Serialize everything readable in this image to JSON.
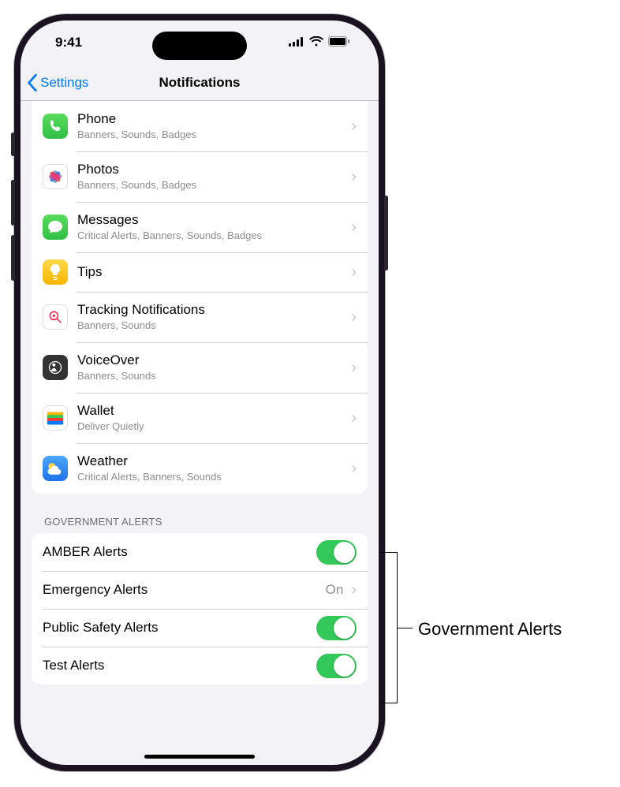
{
  "status": {
    "time": "9:41"
  },
  "nav": {
    "back": "Settings",
    "title": "Notifications"
  },
  "apps": [
    {
      "title": "Phone",
      "subtitle": "Banners, Sounds, Badges",
      "icon": "phone"
    },
    {
      "title": "Photos",
      "subtitle": "Banners, Sounds, Badges",
      "icon": "photos"
    },
    {
      "title": "Messages",
      "subtitle": "Critical Alerts, Banners, Sounds, Badges",
      "icon": "messages"
    },
    {
      "title": "Tips",
      "subtitle": "",
      "icon": "tips"
    },
    {
      "title": "Tracking Notifications",
      "subtitle": "Banners, Sounds",
      "icon": "tracking"
    },
    {
      "title": "VoiceOver",
      "subtitle": "Banners, Sounds",
      "icon": "voiceover"
    },
    {
      "title": "Wallet",
      "subtitle": "Deliver Quietly",
      "icon": "wallet"
    },
    {
      "title": "Weather",
      "subtitle": "Critical Alerts, Banners, Sounds",
      "icon": "weather"
    }
  ],
  "gov": {
    "header": "GOVERNMENT ALERTS",
    "items": [
      {
        "title": "AMBER Alerts",
        "type": "toggle",
        "on": true
      },
      {
        "title": "Emergency Alerts",
        "type": "link",
        "value": "On"
      },
      {
        "title": "Public Safety Alerts",
        "type": "toggle",
        "on": true
      },
      {
        "title": "Test Alerts",
        "type": "toggle",
        "on": true
      }
    ]
  },
  "annotation": "Government Alerts"
}
